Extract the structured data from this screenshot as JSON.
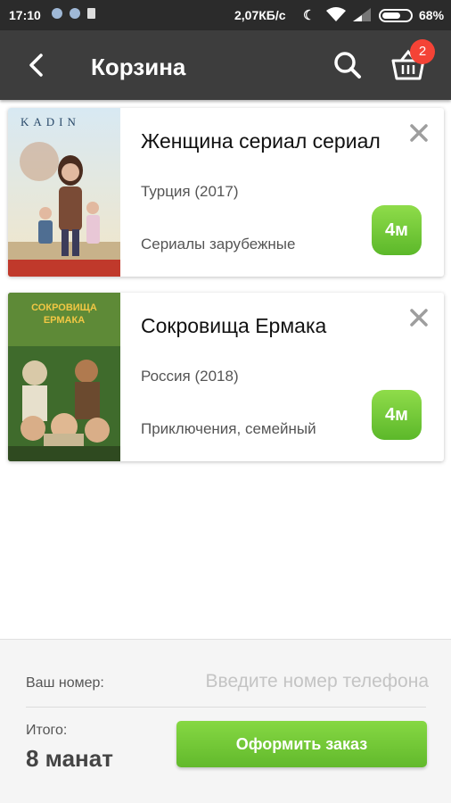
{
  "status_bar": {
    "time": "17:10",
    "speed": "2,07КБ/с",
    "battery": "68%"
  },
  "app_bar": {
    "title": "Корзина",
    "cart_count": "2",
    "icons": [
      "back-arrow-icon",
      "search-icon",
      "basket-icon"
    ]
  },
  "items": [
    {
      "title": "Женщина сериал  сериал",
      "country": "Турция (2017)",
      "genre": "Сериалы зарубежные",
      "price": "4м",
      "poster_text": "KADIN"
    },
    {
      "title": "Сокровища Ермака",
      "country": " Россия (2018)",
      "genre": "Приключения, семейный",
      "price": "4м",
      "poster_text": "СОКРОВИЩА ЕРМАКА"
    }
  ],
  "footer": {
    "phone_label": "Ваш номер:",
    "phone_placeholder": "Введите номер телефона",
    "total_label": "Итого:",
    "total_value": "8 манат",
    "order_button": "Оформить заказ"
  },
  "colors": {
    "app_bar": "#3d3d3d",
    "status_bar": "#2b2b2b",
    "accent_green": "#6cc431",
    "badge_red": "#f44336"
  }
}
